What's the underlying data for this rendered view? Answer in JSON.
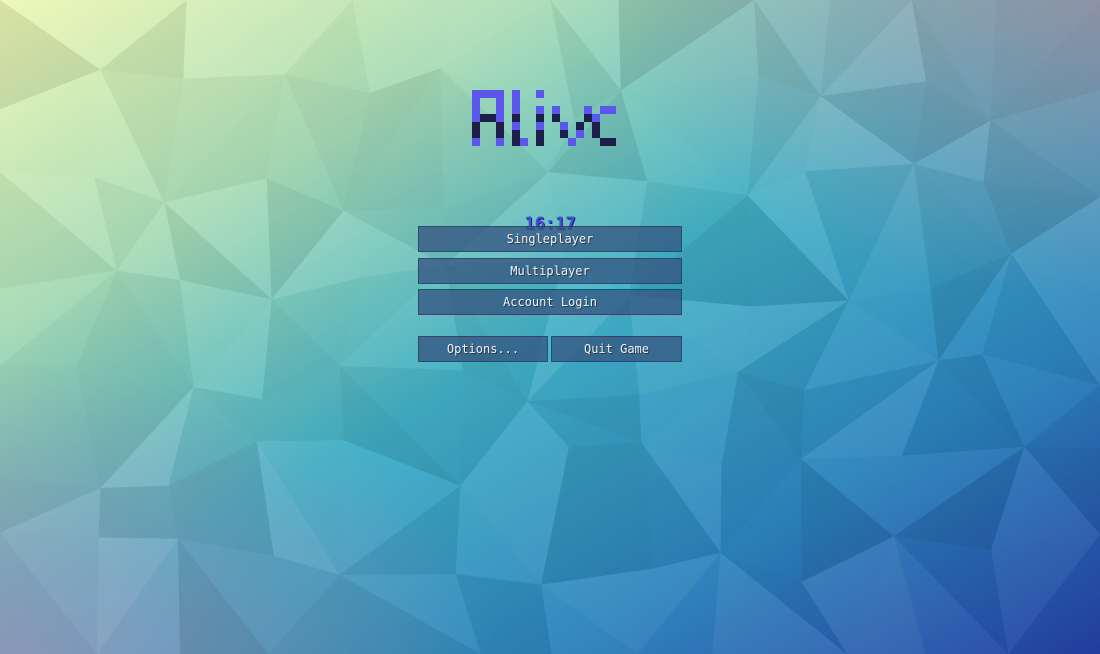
{
  "title": {
    "text": "Alive",
    "colors": {
      "primary": "#5b57ea",
      "shadow": "#1e1e4a"
    }
  },
  "clock": {
    "time": "16:17"
  },
  "menu": {
    "singleplayer_label": "Singleplayer",
    "multiplayer_label": "Multiplayer",
    "account_login_label": "Account Login",
    "options_label": "Options...",
    "quit_label": "Quit Game"
  },
  "theme": {
    "background_top_left": "#e8f7b5",
    "background_center": "#3aaac4",
    "background_bottom_right": "#2644a6",
    "button_color": "#345682"
  }
}
